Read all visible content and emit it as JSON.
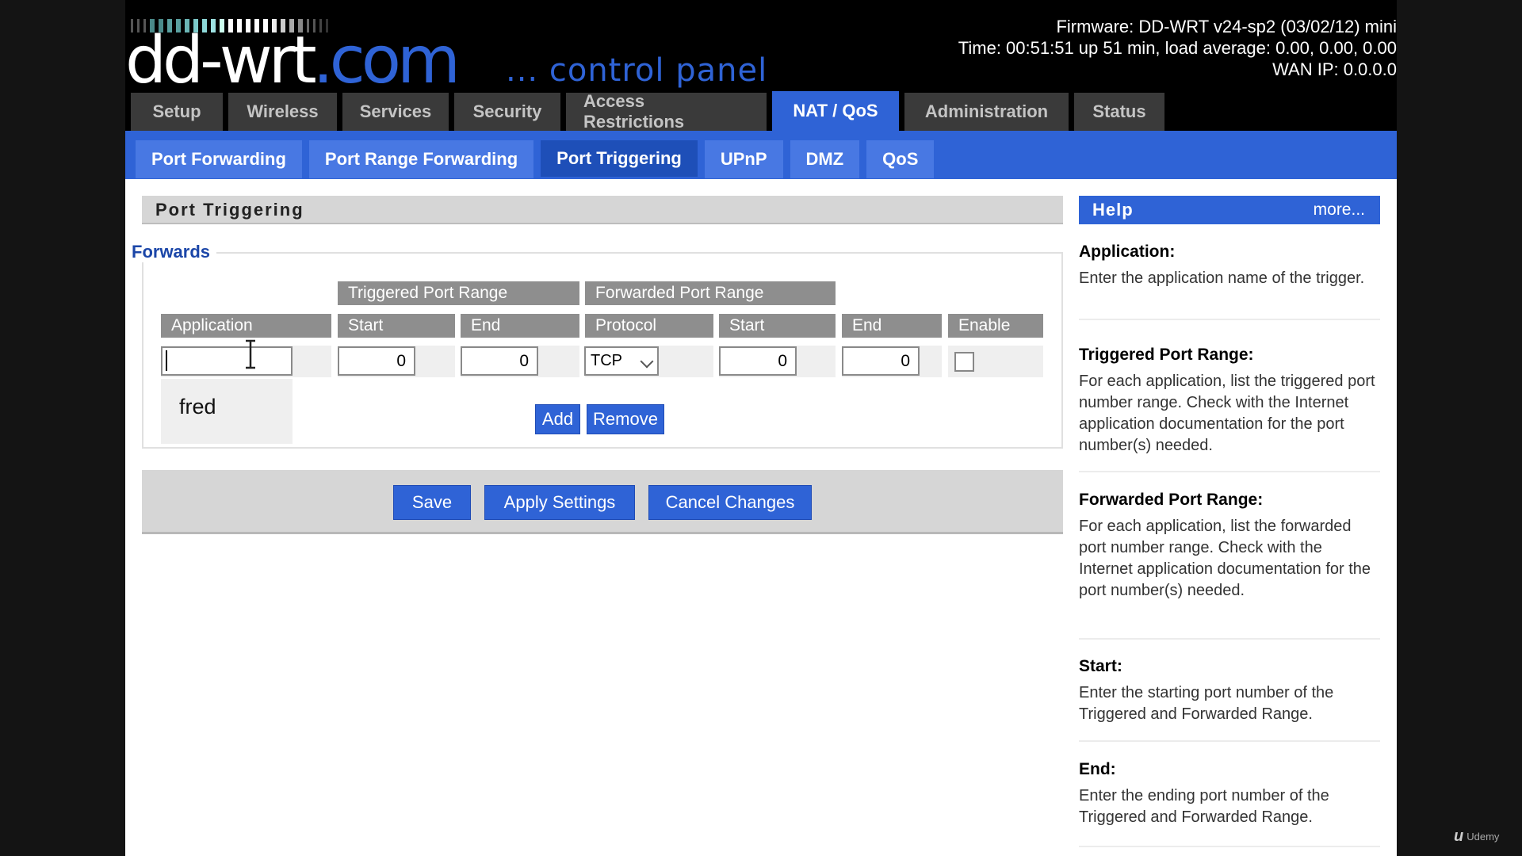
{
  "header": {
    "logo_main": "dd-wrt",
    "logo_suffix": ".com",
    "subtitle": "... control panel",
    "firmware": "Firmware: DD-WRT v24-sp2 (03/02/12) mini",
    "time": "Time: 00:51:51 up 51 min, load average: 0.00, 0.00, 0.00",
    "wan_ip": "WAN IP: 0.0.0.0"
  },
  "main_tabs": [
    {
      "label": "Setup"
    },
    {
      "label": "Wireless"
    },
    {
      "label": "Services"
    },
    {
      "label": "Security"
    },
    {
      "label": "Access Restrictions"
    },
    {
      "label": "NAT / QoS"
    },
    {
      "label": "Administration"
    },
    {
      "label": "Status"
    }
  ],
  "sub_tabs": [
    {
      "label": "Port Forwarding"
    },
    {
      "label": "Port Range Forwarding"
    },
    {
      "label": "Port Triggering"
    },
    {
      "label": "UPnP"
    },
    {
      "label": "DMZ"
    },
    {
      "label": "QoS"
    }
  ],
  "section": {
    "title": "Port Triggering",
    "legend": "Forwards",
    "group_headers": {
      "triggered": "Triggered Port Range",
      "forwarded": "Forwarded Port Range"
    },
    "columns": {
      "application": "Application",
      "start": "Start",
      "end": "End",
      "protocol": "Protocol",
      "start2": "Start",
      "end2": "End",
      "enable": "Enable"
    },
    "row": {
      "application": "",
      "trig_start": "0",
      "trig_end": "0",
      "protocol": "TCP",
      "fwd_start": "0",
      "fwd_end": "0",
      "enabled": false
    },
    "autocomplete": "fred",
    "add_label": "Add",
    "remove_label": "Remove"
  },
  "actions": {
    "save": "Save",
    "apply": "Apply Settings",
    "cancel": "Cancel Changes"
  },
  "help": {
    "title": "Help",
    "more": "more...",
    "sections": [
      {
        "heading": "Application:",
        "text": "Enter the application name of the trigger."
      },
      {
        "heading": "Triggered Port Range:",
        "text": "For each application, list the triggered port number range. Check with the Internet application documentation for the port number(s) needed."
      },
      {
        "heading": "Forwarded Port Range:",
        "text": "For each application, list the forwarded port number range. Check with the Internet application documentation for the port number(s) needed."
      },
      {
        "heading": "Start:",
        "text": "Enter the starting port number of the Triggered and Forwarded Range."
      },
      {
        "heading": "End:",
        "text": "Enter the ending port number of the Triggered and Forwarded Range."
      }
    ]
  },
  "watermark": "Udemy",
  "colors": {
    "accent": "#2f63d6",
    "tab_inactive": "#3a3a3a",
    "header_cell": "#8e8e8e"
  }
}
